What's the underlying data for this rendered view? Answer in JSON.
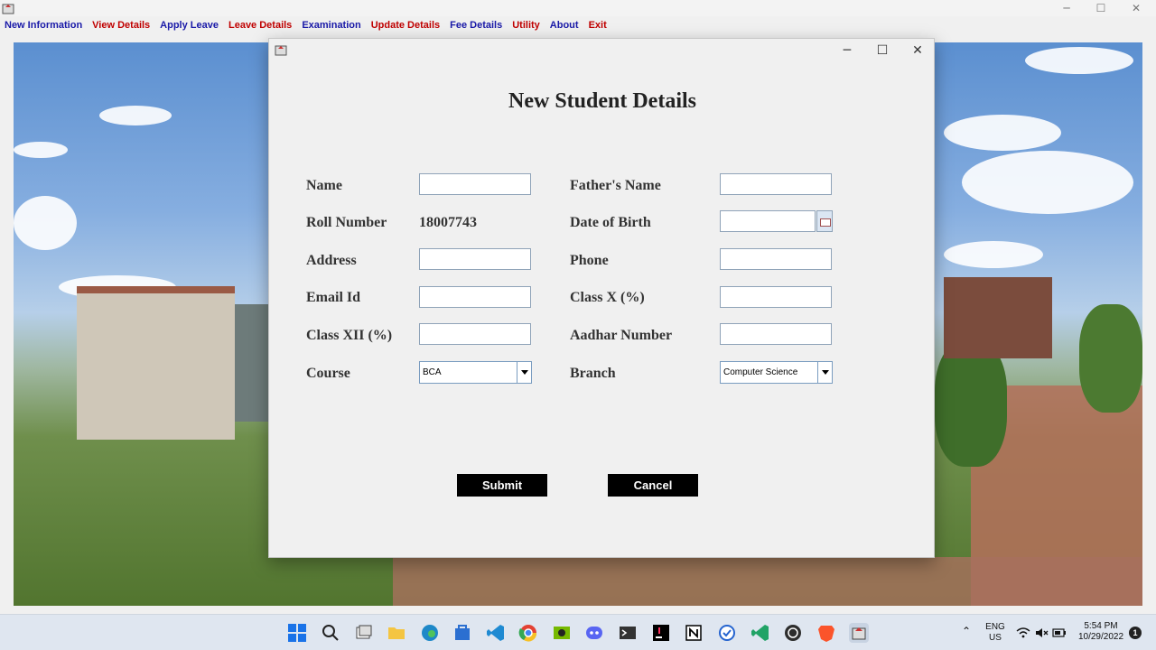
{
  "menu": {
    "items": [
      {
        "label": "New Information",
        "color": "#1a1aa8"
      },
      {
        "label": "View Details",
        "color": "#c00000"
      },
      {
        "label": "Apply Leave",
        "color": "#1a1aa8"
      },
      {
        "label": "Leave Details",
        "color": "#c00000"
      },
      {
        "label": "Examination",
        "color": "#1a1aa8"
      },
      {
        "label": "Update Details",
        "color": "#c00000"
      },
      {
        "label": "Fee Details",
        "color": "#1a1aa8"
      },
      {
        "label": "Utility",
        "color": "#c00000"
      },
      {
        "label": "About",
        "color": "#1a1aa8"
      },
      {
        "label": "Exit",
        "color": "#c00000"
      }
    ]
  },
  "window_controls": {
    "minimize": "─",
    "maximize": "☐",
    "close": "✕"
  },
  "dialog": {
    "title": "New Student Details",
    "labels": {
      "name": "Name",
      "fathers_name": "Father's Name",
      "roll_number": "Roll Number",
      "dob": "Date of Birth",
      "address": "Address",
      "phone": "Phone",
      "email": "Email Id",
      "class_x": "Class X (%)",
      "class_xii": "Class XII (%)",
      "aadhar": "Aadhar Number",
      "course": "Course",
      "branch": "Branch"
    },
    "values": {
      "roll_number": "18007743",
      "name": "",
      "fathers_name": "",
      "dob": "",
      "address": "",
      "phone": "",
      "email": "",
      "class_x": "",
      "class_xii": "",
      "aadhar": "",
      "course": "BCA",
      "branch": "Computer Science"
    },
    "buttons": {
      "submit": "Submit",
      "cancel": "Cancel"
    }
  },
  "taskbar": {
    "lang_top": "ENG",
    "lang_bottom": "US",
    "time": "5:54 PM",
    "date": "10/29/2022",
    "notification_count": "1"
  }
}
